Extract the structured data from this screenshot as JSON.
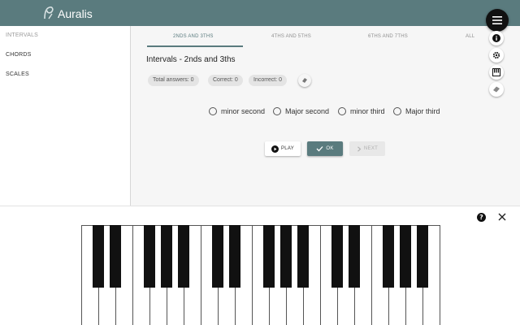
{
  "app": {
    "title": "Auralis"
  },
  "sidebar": {
    "items": [
      {
        "label": "INTERVALS"
      },
      {
        "label": "CHORDS"
      },
      {
        "label": "SCALES"
      }
    ]
  },
  "tabs": [
    {
      "label": "2NDS AND 3THS",
      "active": true
    },
    {
      "label": "4THS AND 5THS",
      "active": false
    },
    {
      "label": "6THS AND 7THS",
      "active": false
    },
    {
      "label": "ALL",
      "active": false
    }
  ],
  "heading": "Intervals - 2nds and 3ths",
  "stats": {
    "total": "Total answers: 0",
    "correct": "Correct: 0",
    "incorrect": "Incorrect: 0"
  },
  "options": [
    {
      "label": "minor second"
    },
    {
      "label": "Major second"
    },
    {
      "label": "minor third"
    },
    {
      "label": "Major third"
    }
  ],
  "buttons": {
    "play": "PLAY",
    "ok": "OK",
    "next": "NEXT"
  },
  "icons": {
    "menu": "menu-icon",
    "info": "info-icon",
    "settings": "gear-icon",
    "piano": "piano-icon",
    "eraser": "eraser-icon",
    "help": "help-icon",
    "close": "close-icon"
  },
  "colors": {
    "header": "#5a7b7e",
    "accent": "#5a7b7e",
    "fab": "#111111"
  },
  "keyboard": {
    "white_keys": 21
  }
}
